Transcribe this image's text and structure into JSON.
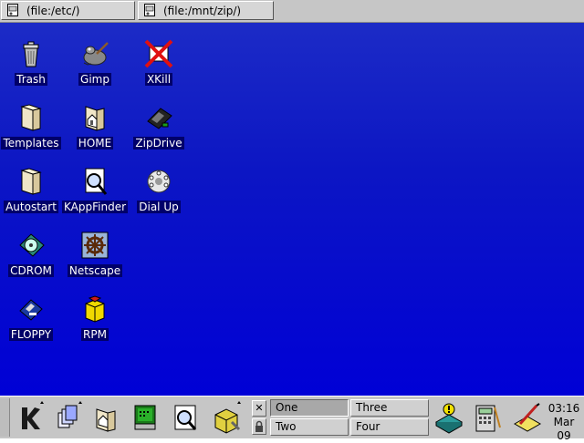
{
  "taskbar": {
    "windows": [
      {
        "label": "(file:/etc/)",
        "icon": "file-manager-icon"
      },
      {
        "label": "(file:/mnt/zip/)",
        "icon": "file-manager-icon"
      }
    ]
  },
  "desktop": {
    "icons": [
      {
        "label": "Trash",
        "icon": "trash-icon"
      },
      {
        "label": "Gimp",
        "icon": "gimp-icon"
      },
      {
        "label": "XKill",
        "icon": "xkill-icon"
      },
      {
        "label": "Templates",
        "icon": "folder-icon"
      },
      {
        "label": "HOME",
        "icon": "home-folder-icon"
      },
      {
        "label": "ZipDrive",
        "icon": "zip-drive-icon"
      },
      {
        "label": "Autostart",
        "icon": "folder-icon"
      },
      {
        "label": "KAppFinder",
        "icon": "kappfinder-icon"
      },
      {
        "label": "Dial Up",
        "icon": "dial-up-icon"
      },
      {
        "label": "CDROM",
        "icon": "cdrom-icon"
      },
      {
        "label": "Netscape",
        "icon": "netscape-icon"
      },
      {
        "label": "FLOPPY",
        "icon": "floppy-icon"
      },
      {
        "label": "RPM",
        "icon": "rpm-package-icon"
      }
    ]
  },
  "panel": {
    "desktops": [
      "One",
      "Two",
      "Three",
      "Four"
    ],
    "active_desktop": "One",
    "clock_time": "03:16",
    "clock_date": "Mar 09"
  },
  "colors": {
    "desktop_top": "#1c2bc6",
    "desktop_bottom": "#0000d6",
    "panel_bg": "#c6c6c6"
  }
}
